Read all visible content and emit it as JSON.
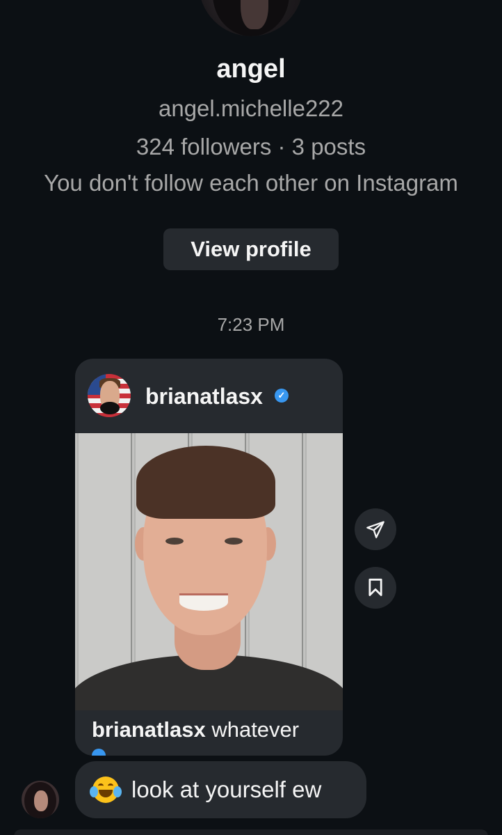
{
  "profile": {
    "display_name": "angel",
    "username": "angel.michelle222",
    "stats": "324 followers · 3 posts",
    "relationship": "You don't follow each other on Instagram",
    "view_profile_label": "View profile"
  },
  "thread": {
    "timestamp": "7:23 PM"
  },
  "shared_post": {
    "author": "brianatlasx",
    "verified": true,
    "caption_author": "brianatlasx",
    "caption_text": "whatever"
  },
  "message": {
    "emoji": "face-with-tears-of-joy",
    "text": "look at yourself ew"
  },
  "icons": {
    "share": "paper-plane-icon",
    "save": "bookmark-icon"
  },
  "colors": {
    "background": "#0c1014",
    "bubble": "#262a2f",
    "secondary_text": "#a8a8a8",
    "verified_blue": "#3897f0"
  }
}
